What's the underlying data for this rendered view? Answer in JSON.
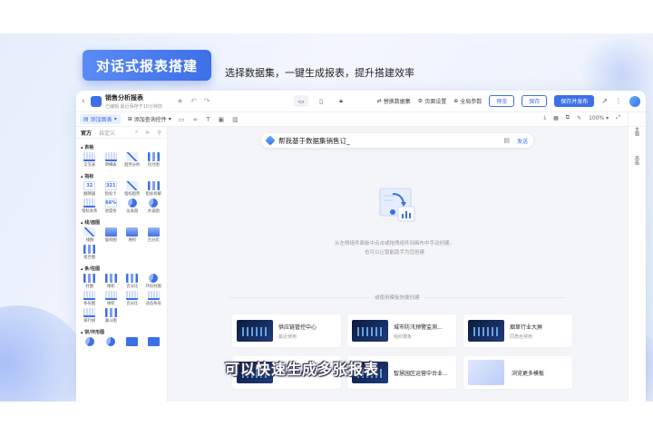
{
  "hero": {
    "badge": "对话式报表搭建",
    "subtitle": "选择数据集，一键生成报表，提升搭建效率"
  },
  "titlebar": {
    "report_name": "销售分析报表",
    "report_status": "已编辑 最近保存于10分钟前",
    "actions": {
      "replace_dataset": "替换数据集",
      "page_settings": "页面设置",
      "global_params": "全局参数",
      "preview": "预览",
      "save": "保存",
      "save_publish": "保存并发布"
    }
  },
  "toolbar": {
    "add_chart": "添加图表",
    "add_query": "添加查询控件",
    "zoom": "100%"
  },
  "left_panel": {
    "tabs": [
      "官方",
      "自定义"
    ],
    "sections": [
      {
        "title": "表格",
        "items": [
          "交叉表",
          "明细表",
          "趋势分析",
          "热力图"
        ]
      },
      {
        "title": "指标",
        "items": [
          "翻牌器",
          "指标卡",
          "指标趋势",
          "指标拆解",
          "指标关系",
          "进度条",
          "仪表盘",
          "水波图"
        ]
      },
      {
        "title": "线/面图",
        "items": [
          "线图",
          "面积图",
          "堆积",
          "百分比",
          "组合图"
        ]
      },
      {
        "title": "条/柱图",
        "items": [
          "柱图",
          "堆积",
          "百分比",
          "环形柱图",
          "条形图",
          "堆积",
          "百分比",
          "动态条形",
          "排行榜",
          "漏斗图"
        ]
      },
      {
        "title": "饼/环形图",
        "items": []
      }
    ],
    "metric_thumb_texts": [
      "32",
      "321",
      "66%"
    ]
  },
  "right_rail": [
    "主题",
    "高级"
  ],
  "canvas": {
    "ai_input": "帮我基于数据集销售订_",
    "ai_send": "发送",
    "empty_line1": "从左侧组件面板中点击或拖拽组件到画布中手动创建。",
    "empty_line2": "也可以让智能助手为您创建",
    "template_divider": "或使用模板快捷创建",
    "templates": [
      {
        "name": "供应链管控中心",
        "tag": "最近使用"
      },
      {
        "name": "城市防汛预警监测...",
        "tag": "组织模板"
      },
      {
        "name": "烟草行业大屏",
        "tag": "同角色常用"
      },
      {
        "name": "物流运营总览看板",
        "tag": ""
      },
      {
        "name": "智慧园区运营中台业...",
        "tag": ""
      },
      {
        "name": "浏览更多模板",
        "tag": ""
      }
    ]
  },
  "caption": "可以快速生成多张报表"
}
